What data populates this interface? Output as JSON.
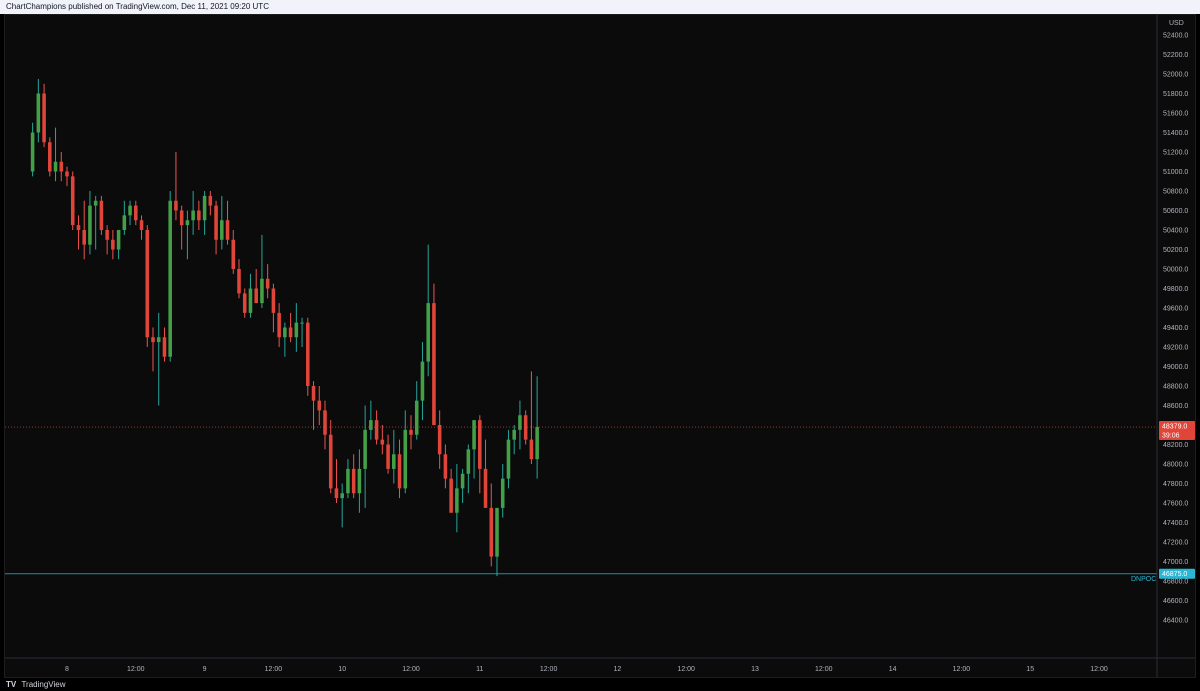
{
  "header": {
    "text": "ChartChampions published on TradingView.com, Dec 11, 2021 09:20 UTC"
  },
  "footer": {
    "logo": "TV",
    "brand": "TradingView"
  },
  "colors": {
    "up": "#26a69a",
    "down": "#ef5350",
    "upBody": "#43a047",
    "downBody": "#e0453a",
    "price_tag": "#e0453a",
    "dnpoc": "#2bb7d3",
    "background": "#0b0b0b"
  },
  "chart_data": {
    "type": "candlestick",
    "currency_label": "USD",
    "ylim": [
      46400,
      52500
    ],
    "y_ticks": [
      52400,
      52200,
      52000,
      51800,
      51600,
      51400,
      51200,
      51000,
      50800,
      50600,
      50400,
      50200,
      50000,
      49800,
      49600,
      49400,
      49200,
      49000,
      48800,
      48600,
      48400,
      48200,
      48000,
      47800,
      47600,
      47400,
      47200,
      47000,
      46800,
      46600,
      46400
    ],
    "y_tick_labels": [
      "52400.0",
      "52200.0",
      "52000.0",
      "51800.0",
      "51600.0",
      "51400.0",
      "51200.0",
      "51000.0",
      "50800.0",
      "50600.0",
      "50400.0",
      "50200.0",
      "50000.0",
      "49800.0",
      "49600.0",
      "49400.0",
      "49200.0",
      "49000.0",
      "48800.0",
      "48600.0",
      "48400.0",
      "48200.0",
      "48000.0",
      "47800.0",
      "47600.0",
      "47400.0",
      "47200.0",
      "47000.0",
      "46800.0",
      "46600.0",
      "46400.0"
    ],
    "x_tick_labels": [
      "8",
      "12:00",
      "9",
      "12:00",
      "10",
      "12:00",
      "11",
      "12:00",
      "12",
      "12:00",
      "13",
      "12:00",
      "14",
      "12:00",
      "15",
      "12:00"
    ],
    "x_tick_hours": [
      24,
      36,
      48,
      60,
      72,
      84,
      96,
      108,
      120,
      132,
      144,
      156,
      168,
      180,
      192,
      204
    ],
    "last_price": {
      "value": 48379.0,
      "label": "48379.0",
      "countdown": "39:06"
    },
    "dnpoc": {
      "value": 46875.0,
      "label": "46875.0",
      "name": "DNPOC"
    },
    "candles_hours_start": 18,
    "candles": [
      [
        51000,
        51500,
        50950,
        51400
      ],
      [
        51400,
        51950,
        51300,
        51800
      ],
      [
        51800,
        51900,
        51250,
        51300
      ],
      [
        51300,
        51350,
        50950,
        51000
      ],
      [
        51000,
        51450,
        50900,
        51100
      ],
      [
        51100,
        51200,
        50900,
        51000
      ],
      [
        51000,
        51050,
        50850,
        50950
      ],
      [
        50950,
        51000,
        50400,
        50450
      ],
      [
        50450,
        50550,
        50200,
        50400
      ],
      [
        50400,
        50700,
        50100,
        50250
      ],
      [
        50250,
        50800,
        50150,
        50650
      ],
      [
        50650,
        50750,
        50200,
        50700
      ],
      [
        50700,
        50750,
        50350,
        50400
      ],
      [
        50400,
        50450,
        50150,
        50300
      ],
      [
        50300,
        50400,
        50100,
        50200
      ],
      [
        50200,
        50350,
        50100,
        50400
      ],
      [
        50400,
        50700,
        50350,
        50550
      ],
      [
        50550,
        50700,
        50450,
        50650
      ],
      [
        50650,
        50700,
        50450,
        50500
      ],
      [
        50500,
        50550,
        50300,
        50400
      ],
      [
        50400,
        50450,
        49200,
        49300
      ],
      [
        49300,
        49400,
        48950,
        49250
      ],
      [
        49250,
        49550,
        48600,
        49300
      ],
      [
        49300,
        49400,
        49050,
        49100
      ],
      [
        49100,
        50800,
        49050,
        50700
      ],
      [
        50700,
        51200,
        50500,
        50600
      ],
      [
        50600,
        50650,
        50200,
        50450
      ],
      [
        50450,
        50600,
        50100,
        50500
      ],
      [
        50500,
        50800,
        50350,
        50600
      ],
      [
        50600,
        50700,
        50400,
        50500
      ],
      [
        50500,
        50800,
        50350,
        50750
      ],
      [
        50750,
        50800,
        50550,
        50650
      ],
      [
        50650,
        50700,
        50150,
        50300
      ],
      [
        50300,
        50750,
        50200,
        50500
      ],
      [
        50500,
        50700,
        50250,
        50300
      ],
      [
        50300,
        50400,
        49950,
        50000
      ],
      [
        50000,
        50100,
        49700,
        49750
      ],
      [
        49750,
        49800,
        49500,
        49550
      ],
      [
        49550,
        49950,
        49500,
        49800
      ],
      [
        49800,
        50000,
        49700,
        49650
      ],
      [
        49650,
        50350,
        49600,
        49900
      ],
      [
        49900,
        50050,
        49700,
        49800
      ],
      [
        49800,
        49850,
        49350,
        49550
      ],
      [
        49550,
        49650,
        49200,
        49300
      ],
      [
        49300,
        49450,
        49100,
        49400
      ],
      [
        49400,
        49550,
        49250,
        49300
      ],
      [
        49300,
        49650,
        49150,
        49450
      ],
      [
        49450,
        49500,
        49200,
        49450
      ],
      [
        49450,
        49500,
        48700,
        48800
      ],
      [
        48800,
        48850,
        48350,
        48650
      ],
      [
        48650,
        48800,
        48400,
        48550
      ],
      [
        48550,
        48650,
        48150,
        48300
      ],
      [
        48300,
        48450,
        47700,
        47750
      ],
      [
        47750,
        48050,
        47600,
        47650
      ],
      [
        47650,
        47800,
        47350,
        47700
      ],
      [
        47700,
        48050,
        47650,
        47950
      ],
      [
        47950,
        48100,
        47650,
        47700
      ],
      [
        47700,
        48150,
        47500,
        47950
      ],
      [
        47950,
        48600,
        47550,
        48350
      ],
      [
        48350,
        48650,
        48250,
        48450
      ],
      [
        48450,
        48550,
        48200,
        48250
      ],
      [
        48250,
        48400,
        48100,
        48200
      ],
      [
        48200,
        48300,
        47900,
        47950
      ],
      [
        47950,
        48350,
        47800,
        48100
      ],
      [
        48100,
        48250,
        47650,
        47750
      ],
      [
        47750,
        48550,
        47700,
        48350
      ],
      [
        48350,
        48500,
        48150,
        48300
      ],
      [
        48300,
        48850,
        48250,
        48650
      ],
      [
        48650,
        49250,
        48450,
        49050
      ],
      [
        49050,
        50250,
        48900,
        49650
      ],
      [
        49650,
        49850,
        48450,
        48400
      ],
      [
        48400,
        48550,
        47950,
        48100
      ],
      [
        48100,
        48200,
        47750,
        47850
      ],
      [
        47850,
        47950,
        47500,
        47500
      ],
      [
        47500,
        48000,
        47300,
        47750
      ],
      [
        47750,
        47950,
        47600,
        47900
      ],
      [
        47900,
        48200,
        47700,
        48150
      ],
      [
        48150,
        48450,
        47850,
        48450
      ],
      [
        48450,
        48500,
        47700,
        47950
      ],
      [
        47950,
        48250,
        47650,
        47550
      ],
      [
        47550,
        47800,
        46950,
        47050
      ],
      [
        47050,
        47500,
        46850,
        47550
      ],
      [
        47550,
        48000,
        47450,
        47850
      ],
      [
        47850,
        48350,
        47750,
        48250
      ],
      [
        48250,
        48400,
        48100,
        48350
      ],
      [
        48350,
        48650,
        48150,
        48500
      ],
      [
        48500,
        48550,
        48200,
        48250
      ],
      [
        48250,
        48950,
        48000,
        48050
      ],
      [
        48050,
        48900,
        47850,
        48379
      ]
    ]
  }
}
